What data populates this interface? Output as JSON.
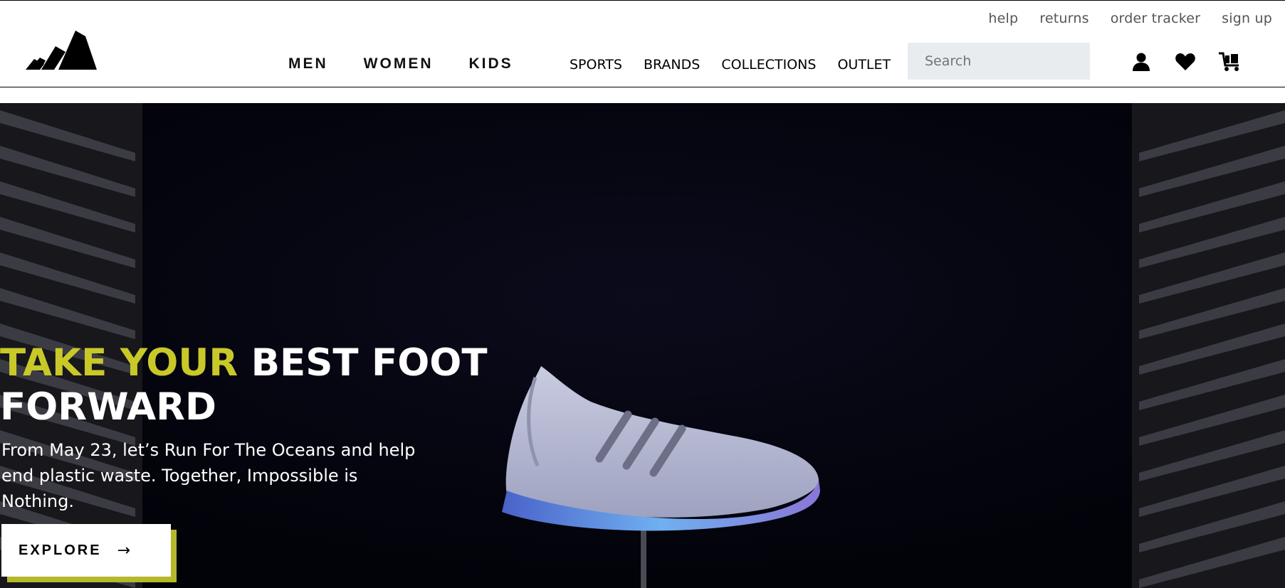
{
  "header": {
    "utility_links": [
      "help",
      "returns",
      "order tracker",
      "sign up"
    ],
    "main_nav": [
      "MEN",
      "WOMEN",
      "KIDS"
    ],
    "sub_nav": [
      "SPORTS",
      "BRANDS",
      "COLLECTIONS",
      "OUTLET"
    ],
    "search": {
      "placeholder": "Search",
      "value": ""
    },
    "icons": [
      "user-icon",
      "heart-icon",
      "cart-icon"
    ],
    "logo_icon": "adidas-performance-logo-icon"
  },
  "hero": {
    "headline_accent": "TAKE YOUR",
    "headline_rest": "BEST FOOT FORWARD",
    "subtext": "From May 23, let’s Run For The Oceans and help end plastic waste. Together, Impossible is Nothing.",
    "cta_label": "EXPLORE",
    "cta_arrow": "→",
    "image_icon": "running-shoe-image"
  },
  "colors": {
    "accent": "#c9c829",
    "hero_bg": "#03030f",
    "search_bg": "#e9ecef"
  }
}
